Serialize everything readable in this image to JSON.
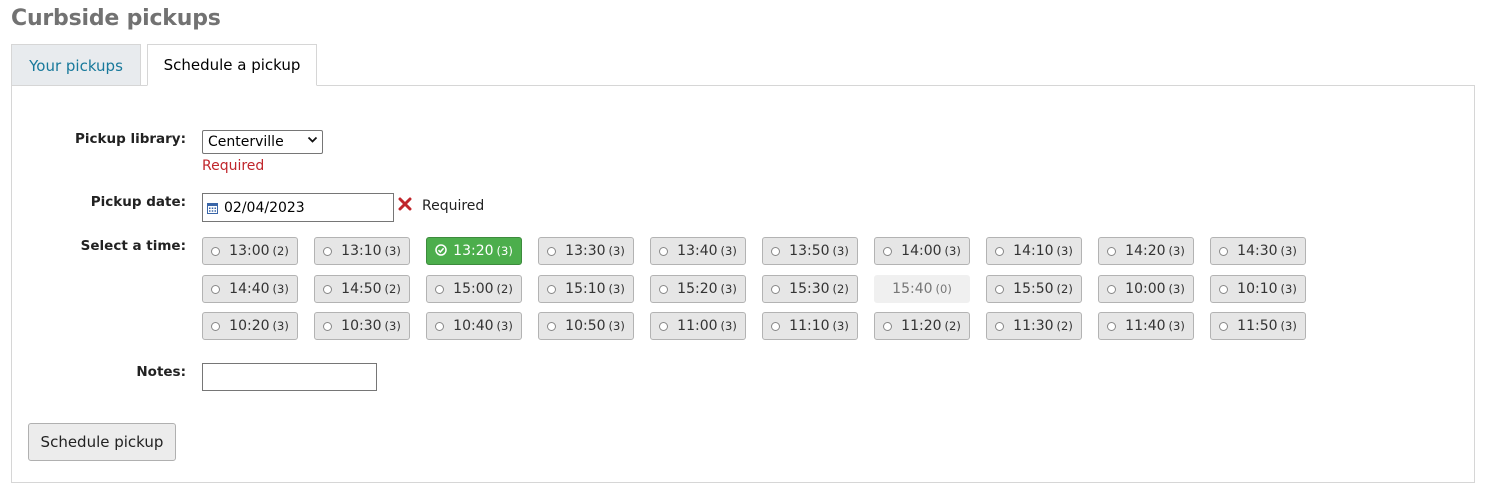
{
  "page": {
    "title": "Curbside pickups"
  },
  "tabs": [
    {
      "label": "Your pickups",
      "active": false
    },
    {
      "label": "Schedule a pickup",
      "active": true
    }
  ],
  "form": {
    "library_label": "Pickup library:",
    "library_value": "Centerville",
    "library_required": "Required",
    "date_label": "Pickup date:",
    "date_value": "02/04/2023",
    "date_required": "Required",
    "time_label": "Select a time:",
    "notes_label": "Notes:",
    "notes_value": "",
    "submit_label": "Schedule pickup"
  },
  "time_slots": [
    {
      "time": "13:00",
      "count": "(2)",
      "state": "normal"
    },
    {
      "time": "13:10",
      "count": "(3)",
      "state": "normal"
    },
    {
      "time": "13:20",
      "count": "(3)",
      "state": "selected"
    },
    {
      "time": "13:30",
      "count": "(3)",
      "state": "normal"
    },
    {
      "time": "13:40",
      "count": "(3)",
      "state": "normal"
    },
    {
      "time": "13:50",
      "count": "(3)",
      "state": "normal"
    },
    {
      "time": "14:00",
      "count": "(3)",
      "state": "normal"
    },
    {
      "time": "14:10",
      "count": "(3)",
      "state": "normal"
    },
    {
      "time": "14:20",
      "count": "(3)",
      "state": "normal"
    },
    {
      "time": "14:30",
      "count": "(3)",
      "state": "normal"
    },
    {
      "time": "14:40",
      "count": "(3)",
      "state": "normal"
    },
    {
      "time": "14:50",
      "count": "(2)",
      "state": "normal"
    },
    {
      "time": "15:00",
      "count": "(2)",
      "state": "normal"
    },
    {
      "time": "15:10",
      "count": "(3)",
      "state": "normal"
    },
    {
      "time": "15:20",
      "count": "(3)",
      "state": "normal"
    },
    {
      "time": "15:30",
      "count": "(2)",
      "state": "normal"
    },
    {
      "time": "15:40",
      "count": "(0)",
      "state": "disabled"
    },
    {
      "time": "15:50",
      "count": "(2)",
      "state": "normal"
    },
    {
      "time": "10:00",
      "count": "(3)",
      "state": "normal"
    },
    {
      "time": "10:10",
      "count": "(3)",
      "state": "normal"
    },
    {
      "time": "10:20",
      "count": "(3)",
      "state": "normal"
    },
    {
      "time": "10:30",
      "count": "(3)",
      "state": "normal"
    },
    {
      "time": "10:40",
      "count": "(3)",
      "state": "normal"
    },
    {
      "time": "10:50",
      "count": "(3)",
      "state": "normal"
    },
    {
      "time": "11:00",
      "count": "(3)",
      "state": "normal"
    },
    {
      "time": "11:10",
      "count": "(3)",
      "state": "normal"
    },
    {
      "time": "11:20",
      "count": "(2)",
      "state": "normal"
    },
    {
      "time": "11:30",
      "count": "(2)",
      "state": "normal"
    },
    {
      "time": "11:40",
      "count": "(3)",
      "state": "normal"
    },
    {
      "time": "11:50",
      "count": "(3)",
      "state": "normal"
    }
  ],
  "icons": {
    "calendar": "calendar-icon",
    "clear": "clear-icon",
    "check": "check-circle-icon",
    "dropdown": "chevron-down-icon"
  },
  "colors": {
    "title": "#727272",
    "link": "#18799b",
    "required": "#c0262c",
    "selected": "#4cae4c"
  }
}
